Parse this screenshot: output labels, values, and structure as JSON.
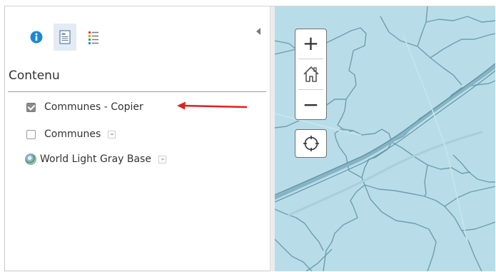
{
  "panel": {
    "tabs": [
      {
        "icon": "info-icon",
        "active": false
      },
      {
        "icon": "layers-content-icon",
        "active": true
      },
      {
        "icon": "legend-icon",
        "active": false
      }
    ],
    "title": "Contenu",
    "layers": [
      {
        "label": "Communes - Copier",
        "checked": true,
        "has_menu": false
      },
      {
        "label": "Communes",
        "checked": false,
        "has_menu": true
      },
      {
        "label": "World Light Gray Base",
        "basemap": true,
        "has_menu": true
      }
    ]
  },
  "map": {
    "water_color": "#b9dde8",
    "boundary_color": "#6c9eb0",
    "controls": {
      "zoom_in": "+",
      "home": "home-icon",
      "zoom_out": "−",
      "locate": "locate-icon"
    }
  },
  "annotation": {
    "arrow_color": "#e02020"
  }
}
